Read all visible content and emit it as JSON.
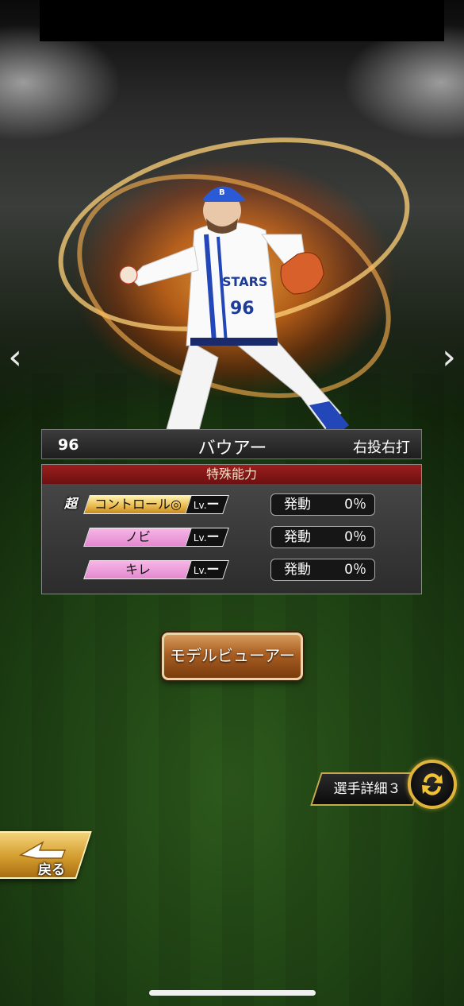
{
  "player": {
    "number": "96",
    "name": "バウアー",
    "handedness": "右投右打",
    "jersey_number": "96",
    "team_text": "STARS"
  },
  "abilities": {
    "title": "特殊能力",
    "items": [
      {
        "super_mark": "超",
        "name": "コントロール◎",
        "lv_prefix": "Lv.",
        "lv_value": "ー",
        "rate_label": "発動",
        "rate_value": "0％",
        "style": "gold"
      },
      {
        "name": "ノビ",
        "lv_prefix": "Lv.",
        "lv_value": "ー",
        "rate_label": "発動",
        "rate_value": "0％",
        "style": "pink"
      },
      {
        "name": "キレ",
        "lv_prefix": "Lv.",
        "lv_value": "ー",
        "rate_label": "発動",
        "rate_value": "0％",
        "style": "pink"
      }
    ]
  },
  "buttons": {
    "model_viewer": "モデルビューアー",
    "player_detail": "選手詳細３",
    "back": "戻る"
  },
  "nav": {
    "prev": "‹",
    "next": "›"
  },
  "icons": {
    "prev": "chevron-left-icon",
    "next": "chevron-right-icon",
    "swap": "swap-arrows-icon",
    "back": "back-arrow-icon"
  },
  "colors": {
    "ability_header": "#8a1a1a",
    "gold_ability": "#e9b84a",
    "pink_ability": "#e488cf",
    "viewer_button": "#a85e22",
    "detail_border": "#c9a94e"
  }
}
